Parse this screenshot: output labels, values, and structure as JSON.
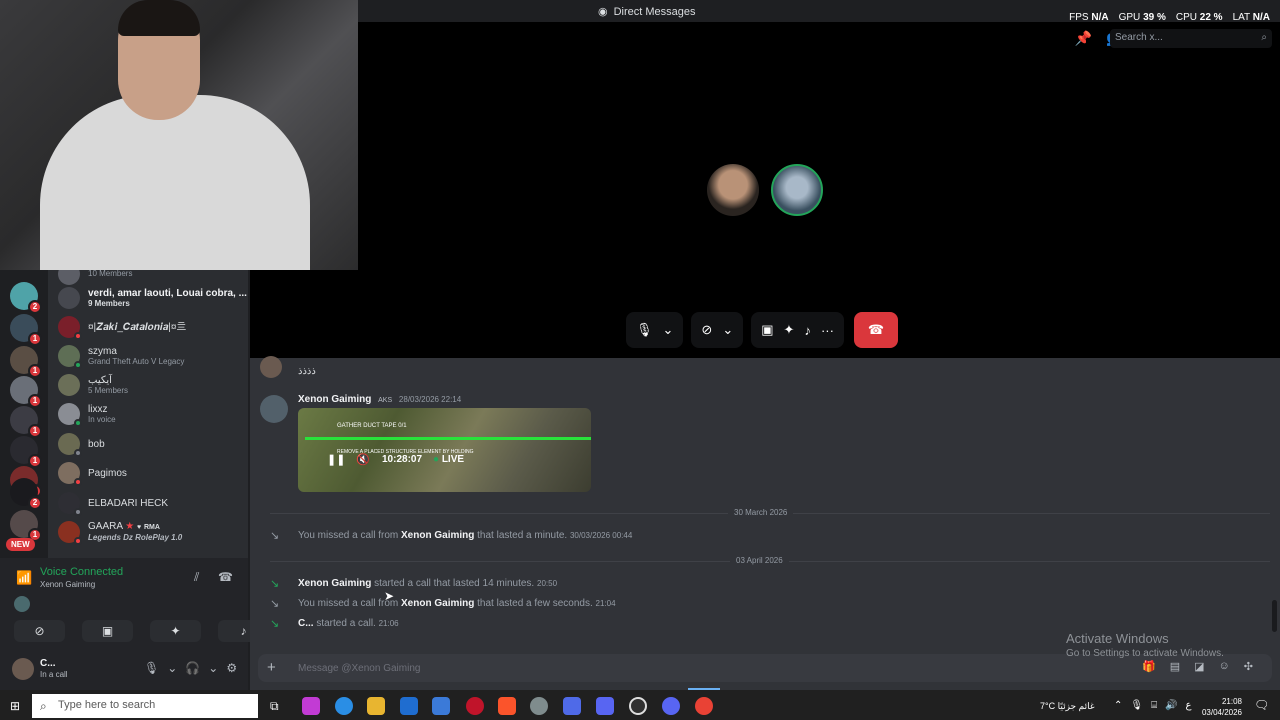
{
  "window": {
    "title": "Direct Messages"
  },
  "stats": {
    "fps_label": "FPS",
    "fps": "N/A",
    "gpu_label": "GPU",
    "gpu": "39 %",
    "cpu_label": "CPU",
    "cpu": "22 %",
    "lat_label": "LAT",
    "lat": "N/A"
  },
  "search": {
    "placeholder": "Search x..."
  },
  "dm_list": [
    {
      "name": "",
      "sub": "10 Members"
    },
    {
      "name": "verdi, amar laouti, Louai cobra, ...",
      "sub": "9 Members"
    },
    {
      "name": "¤|𝒁𝒂𝒌𝒊_𝑪𝒂𝒕𝒂𝒍𝒐𝒏𝒊𝒂|¤亖",
      "sub": ""
    },
    {
      "name": "szyma",
      "sub": "Grand Theft Auto V Legacy"
    },
    {
      "name": "آيكيب",
      "sub": "5 Members"
    },
    {
      "name": "lixxz",
      "sub": "In voice"
    },
    {
      "name": "bob",
      "sub": ""
    },
    {
      "name": "Pagimos",
      "sub": ""
    },
    {
      "name": "ELBADARI HECK",
      "sub": ""
    },
    {
      "name": "GAARA",
      "tag": "RMA",
      "sub": "Legends Dz RolePlay 1.0"
    }
  ],
  "servers": {
    "badges": [
      "1",
      "2",
      "1",
      "1",
      "1",
      "1",
      "1",
      "1",
      "2",
      "1"
    ],
    "new_label": "NEW"
  },
  "voice": {
    "title": "Voice Connected",
    "channel": "Xenon Gaiming"
  },
  "user": {
    "name": "C...",
    "status": "In a call"
  },
  "chat": {
    "msg1_text": "ذذذذ",
    "msg2_author": "Xenon Gaiming",
    "msg2_tag": "AKS",
    "msg2_time": "28/03/2026 22:14",
    "video_title": "GATHER DUCT TAPE 0/1",
    "video_sub": "REMOVE A PLACED STRUCTURE ELEMENT BY HOLDING",
    "video_time": "10:28:07",
    "video_live": "LIVE",
    "date1": "30 March 2026",
    "missed1_pre": "You missed a call from",
    "missed1_name": "Xenon Gaiming",
    "missed1_post": "that lasted a minute.",
    "missed1_time": "30/03/2026 00:44",
    "date2": "03 April 2026",
    "call2_name": "Xenon Gaiming",
    "call2_text": "started a call that lasted 14 minutes.",
    "call2_time": "20:50",
    "missed2_pre": "You missed a call from",
    "missed2_name": "Xenon Gaiming",
    "missed2_post": "that lasted a few seconds.",
    "missed2_time": "21:04",
    "call3_name": "C...",
    "call3_text": "started a call.",
    "call3_time": "21:06"
  },
  "composer": {
    "placeholder": "Message @Xenon Gaiming"
  },
  "watermark": {
    "line1": "Activate Windows",
    "line2": "Go to Settings to activate Windows."
  },
  "taskbar": {
    "search": "Type here to search",
    "weather": "7°C  غائم جزئيًا",
    "lang": "ع",
    "time": "21:08",
    "date": "03/04/2026"
  },
  "colors": {
    "accent": "#23a55a",
    "end_call": "#da373c",
    "chat_bg": "#313338"
  }
}
